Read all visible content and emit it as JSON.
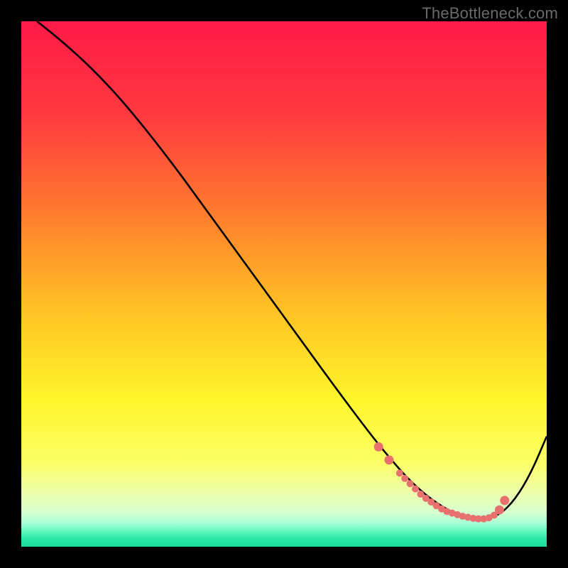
{
  "watermark": "TheBottleneck.com",
  "colors": {
    "bg": "#000000",
    "curve": "#000000",
    "marker_fill": "#e8716f",
    "marker_stroke": "#e8716f",
    "gradient_stops": [
      {
        "offset": 0.0,
        "color": "#ff1a47"
      },
      {
        "offset": 0.18,
        "color": "#ff3a3f"
      },
      {
        "offset": 0.36,
        "color": "#ff7a2e"
      },
      {
        "offset": 0.54,
        "color": "#ffbf24"
      },
      {
        "offset": 0.72,
        "color": "#fff62a"
      },
      {
        "offset": 0.84,
        "color": "#fbff66"
      },
      {
        "offset": 0.9,
        "color": "#ecffb0"
      },
      {
        "offset": 0.935,
        "color": "#d6ffd0"
      },
      {
        "offset": 0.955,
        "color": "#a8ffd6"
      },
      {
        "offset": 0.972,
        "color": "#5cf7b8"
      },
      {
        "offset": 0.985,
        "color": "#29e8a5"
      },
      {
        "offset": 1.0,
        "color": "#1ddd9c"
      }
    ]
  },
  "chart_data": {
    "type": "line",
    "title": "",
    "xlabel": "",
    "ylabel": "",
    "xlim": [
      0,
      100
    ],
    "ylim": [
      0,
      100
    ],
    "grid": false,
    "legend": false,
    "series": [
      {
        "name": "curve",
        "x": [
          3,
          8,
          14,
          20,
          28,
          36,
          44,
          52,
          60,
          66,
          70,
          74,
          78,
          82,
          85,
          88,
          91,
          94,
          97,
          100
        ],
        "y": [
          100,
          96,
          90.5,
          84,
          74,
          63,
          52,
          41,
          30,
          22,
          17,
          12.5,
          9,
          6.5,
          5.4,
          5.2,
          6,
          9,
          14,
          21
        ]
      }
    ],
    "markers": {
      "name": "highlight-points",
      "x": [
        68,
        70,
        72,
        73,
        74,
        75,
        76,
        77,
        78,
        79,
        80,
        81,
        82,
        83,
        84,
        85,
        86,
        87,
        88,
        89,
        90,
        91,
        92
      ],
      "y": [
        19,
        16.5,
        14,
        13,
        12,
        11,
        10,
        9.2,
        8.5,
        7.8,
        7.2,
        6.7,
        6.4,
        6.1,
        5.8,
        5.6,
        5.4,
        5.3,
        5.3,
        5.5,
        6.0,
        7.0,
        8.8
      ],
      "radius_large": 6.5,
      "radius_small": 5.0
    }
  }
}
